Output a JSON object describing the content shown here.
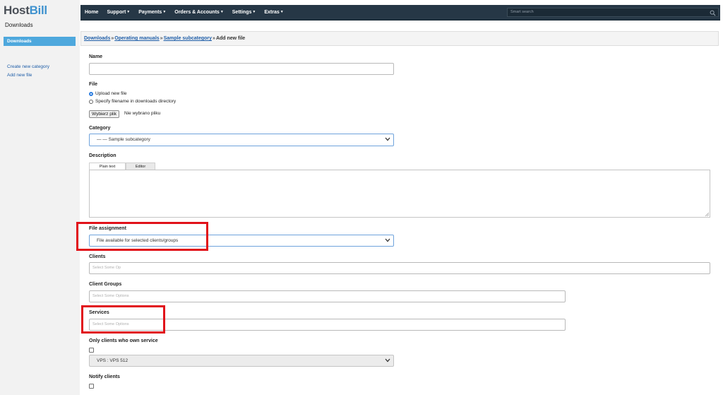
{
  "logo": {
    "host": "Host",
    "bill": "Bill"
  },
  "section_title": "Downloads",
  "sidebar": {
    "active_item": "Downloads",
    "links": [
      "Create new category",
      "Add new file"
    ]
  },
  "nav": {
    "items": [
      {
        "label": "Home",
        "caret": false
      },
      {
        "label": "Support",
        "caret": true
      },
      {
        "label": "Payments",
        "caret": true
      },
      {
        "label": "Orders & Accounts",
        "caret": true
      },
      {
        "label": "Settings",
        "caret": true
      },
      {
        "label": "Extras",
        "caret": true
      }
    ],
    "search_placeholder": "Smart search"
  },
  "breadcrumb": {
    "links": [
      "Downloads",
      "Operating manuals",
      "Sample subcategory"
    ],
    "separator": "»",
    "current": "Add new file"
  },
  "form": {
    "name_label": "Name",
    "file_label": "File",
    "file_options": [
      "Upload new file",
      "Specify filename in downloads directory"
    ],
    "file_selected_index": 0,
    "file_button": "Wybierz plik",
    "file_status": "Nie wybrano pliku",
    "category_label": "Category",
    "category_value": "— — Sample subcategory",
    "description_label": "Description",
    "description_tabs": [
      "Plain text",
      "Editor"
    ],
    "description_active_tab": "Plain text",
    "assignment_label": "File assignment",
    "assignment_value": "File available for selected clients/groups",
    "clients_label": "Clients",
    "clients_placeholder": "Select Some Op",
    "client_groups_label": "Client Groups",
    "client_groups_placeholder": "Select Some Options",
    "services_label": "Services",
    "services_placeholder": "Select Some Options",
    "only_owners_label": "Only clients who own service",
    "only_owners_checked": false,
    "service_select_value": "VPS : VPS 512",
    "notify_label": "Notify clients",
    "notify_checked": false
  },
  "colors": {
    "nav_bg": "#263746",
    "sidebar_active": "#4ea8dd",
    "link": "#1f5ea8",
    "highlight": "#e1121a",
    "logo_accent": "#3f92cf"
  }
}
